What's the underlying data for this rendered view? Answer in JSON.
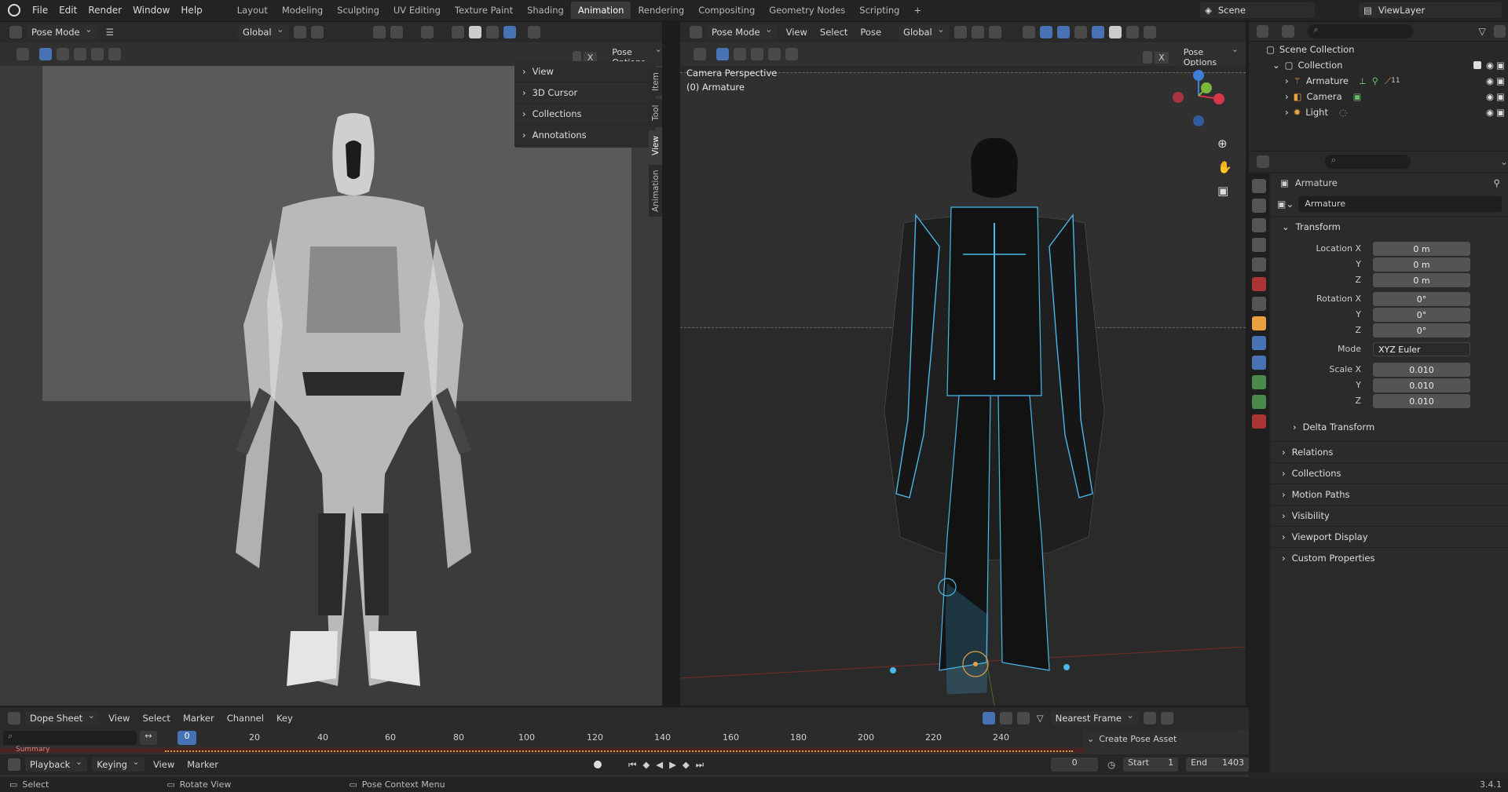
{
  "topbar": {
    "menu": [
      "File",
      "Edit",
      "Render",
      "Window",
      "Help"
    ],
    "workspaces": [
      "Layout",
      "Modeling",
      "Sculpting",
      "UV Editing",
      "Texture Paint",
      "Shading",
      "Animation",
      "Rendering",
      "Compositing",
      "Geometry Nodes",
      "Scripting"
    ],
    "active_workspace": "Animation",
    "scene": "Scene",
    "view_layer": "ViewLayer"
  },
  "left_view": {
    "mode": "Pose Mode",
    "orientation": "Global",
    "pose_options": "Pose Options",
    "npanel": [
      "View",
      "3D Cursor",
      "Collections",
      "Annotations"
    ],
    "tabs": [
      "Item",
      "Tool",
      "View",
      "Animation"
    ],
    "active_tab": "View"
  },
  "right_view": {
    "mode": "Pose Mode",
    "menus": [
      "View",
      "Select",
      "Pose"
    ],
    "orientation": "Global",
    "pose_options": "Pose Options",
    "overlay_title": "Camera Perspective",
    "overlay_object": "(0) Armature"
  },
  "outliner": {
    "root": "Scene Collection",
    "collection": "Collection",
    "items": [
      "Armature",
      "Camera",
      "Light"
    ],
    "armature_badge": "11"
  },
  "properties": {
    "object_name": "Armature",
    "data_name": "Armature",
    "transform_header": "Transform",
    "location_label": "Location X",
    "rotation_label": "Rotation X",
    "scale_label": "Scale X",
    "y_label": "Y",
    "z_label": "Z",
    "location": [
      "0 m",
      "0 m",
      "0 m"
    ],
    "rotation": [
      "0°",
      "0°",
      "0°"
    ],
    "mode_label": "Mode",
    "mode_value": "XYZ Euler",
    "scale": [
      "0.010",
      "0.010",
      "0.010"
    ],
    "sections": [
      "Delta Transform",
      "Relations",
      "Collections",
      "Motion Paths",
      "Visibility",
      "Viewport Display",
      "Custom Properties"
    ],
    "version": "3.4.1"
  },
  "dopesheet": {
    "mode": "Dope Sheet",
    "menus": [
      "View",
      "Select",
      "Marker",
      "Channel",
      "Key"
    ],
    "snap": "Nearest Frame",
    "summary": "Summary",
    "frame_ticks": [
      "0",
      "20",
      "40",
      "60",
      "80",
      "100",
      "120",
      "140",
      "160",
      "180",
      "200",
      "220",
      "240"
    ],
    "create_pose_asset": "Create Pose Asset"
  },
  "playback": {
    "menus": [
      "Playback",
      "Keying",
      "View",
      "Marker"
    ],
    "current_frame": "0",
    "start_label": "Start",
    "start": "1",
    "end_label": "End",
    "end": "1403"
  },
  "status": {
    "select": "Select",
    "rotate": "Rotate View",
    "context": "Pose Context Menu"
  },
  "colors": {
    "accent": "#4772b3",
    "x_axis": "#d9364a",
    "y_axis": "#7bb83a",
    "z_axis": "#3d7ed6",
    "bone_blue": "#4ab8e8"
  }
}
